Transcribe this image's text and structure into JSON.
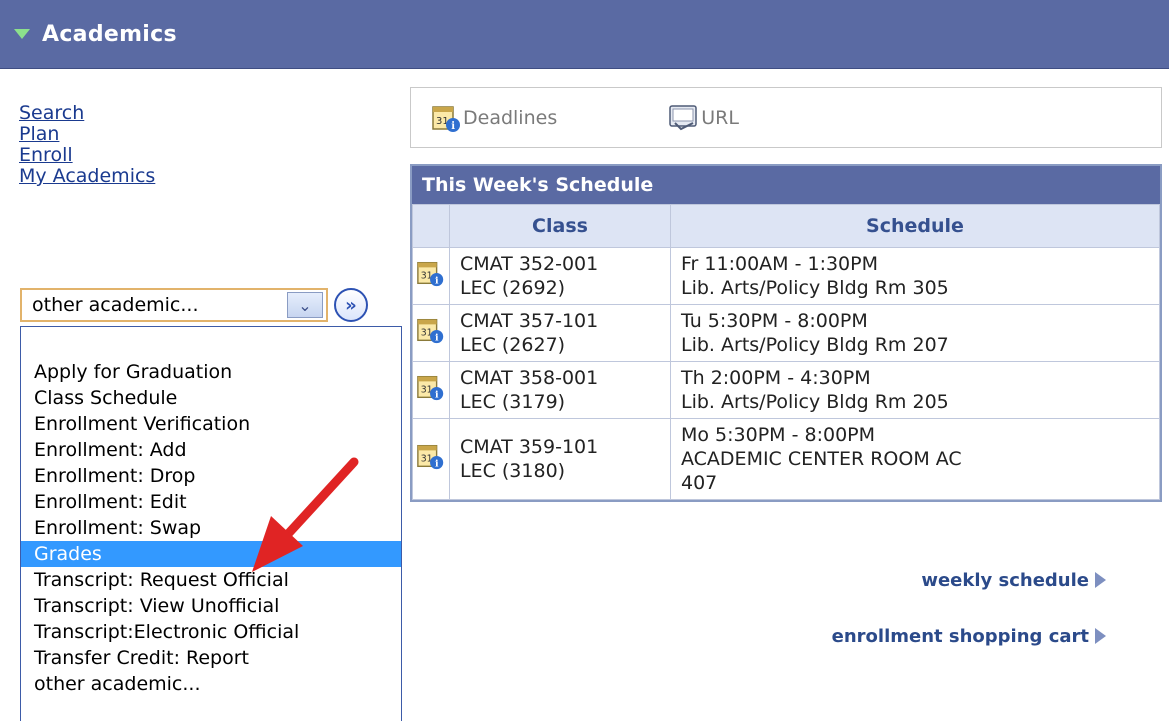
{
  "header": {
    "title": "Academics"
  },
  "nav_links": [
    "Search",
    "Plan",
    "Enroll",
    "My Academics"
  ],
  "select": {
    "value": "other academic...",
    "go_label": "»"
  },
  "dropdown": {
    "options": [
      "Apply for Graduation",
      "Class Schedule",
      "Enrollment Verification",
      "Enrollment: Add",
      "Enrollment: Drop",
      "Enrollment: Edit",
      "Enrollment: Swap",
      "Grades",
      "Transcript: Request Official",
      "Transcript: View Unofficial",
      "Transcript:Electronic Official",
      "Transfer Credit: Report",
      "other academic..."
    ],
    "selected": "Grades"
  },
  "toolbar": {
    "deadlines": "Deadlines",
    "url": "URL"
  },
  "schedule": {
    "title": "This Week's Schedule",
    "columns": [
      "Class",
      "Schedule"
    ],
    "rows": [
      {
        "class": [
          "CMAT 352-001",
          "LEC (2692)"
        ],
        "schedule": [
          "Fr 11:00AM - 1:30PM",
          "Lib. Arts/Policy Bldg  Rm 305"
        ]
      },
      {
        "class": [
          "CMAT 357-101",
          "LEC (2627)"
        ],
        "schedule": [
          "Tu 5:30PM - 8:00PM",
          "Lib. Arts/Policy Bldg  Rm 207"
        ]
      },
      {
        "class": [
          "CMAT 358-001",
          "LEC (3179)"
        ],
        "schedule": [
          "Th 2:00PM - 4:30PM",
          "Lib. Arts/Policy Bldg  Rm 205"
        ]
      },
      {
        "class": [
          "CMAT 359-101",
          "LEC (3180)"
        ],
        "schedule": [
          "Mo 5:30PM - 8:00PM",
          "ACADEMIC CENTER  ROOM AC",
          "407"
        ]
      }
    ]
  },
  "links": {
    "weekly": "weekly schedule",
    "cart": "enrollment shopping cart"
  },
  "colors": {
    "header_bg": "#5a6aa3",
    "highlight": "#3399ff",
    "arrow": "#e02424",
    "link": "#1a3a8f"
  }
}
